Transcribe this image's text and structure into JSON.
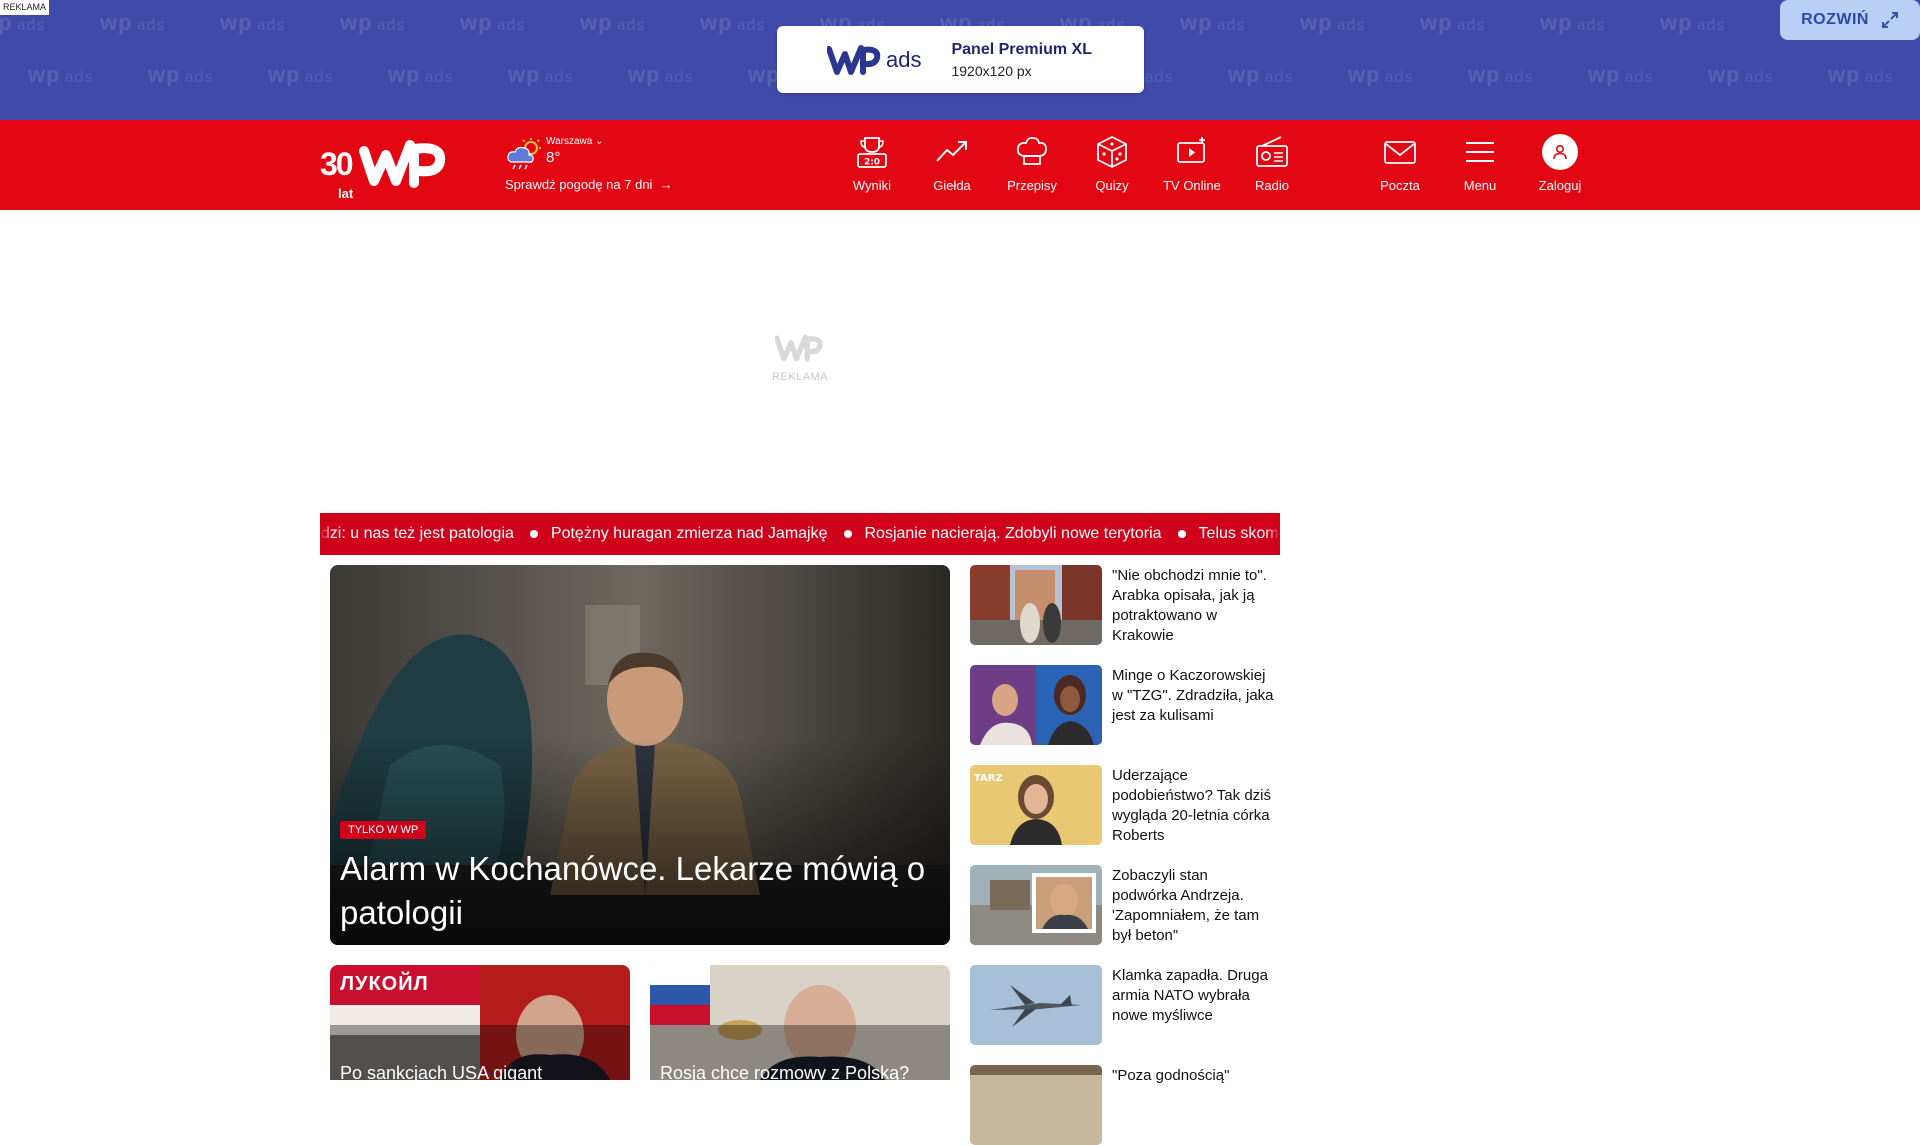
{
  "ad_banner": {
    "tag": "REKLAMA",
    "pattern_text": "wp",
    "pattern_suffix": "ads",
    "brand": "ads",
    "title": "Panel Premium XL",
    "subtitle": "1920x120 px",
    "expand_label": "ROZWIŃ",
    "background_color": "#3f4aa9"
  },
  "header": {
    "logo_years": "30",
    "logo_years_suffix": "lat",
    "brand_color": "#e30613",
    "weather": {
      "city": "Warszawa",
      "temperature": "8°",
      "forecast_link": "Sprawdź pogodę na 7 dni"
    },
    "nav": [
      {
        "label": "Wyniki",
        "icon": "trophy-score-icon"
      },
      {
        "label": "Giełda",
        "icon": "trending-up-icon"
      },
      {
        "label": "Przepisy",
        "icon": "chef-hat-icon"
      },
      {
        "label": "Quizy",
        "icon": "dice-icon"
      },
      {
        "label": "TV Online",
        "icon": "tv-play-icon"
      },
      {
        "label": "Radio",
        "icon": "radio-icon"
      }
    ],
    "account_nav": [
      {
        "label": "Poczta",
        "icon": "mail-icon"
      },
      {
        "label": "Menu",
        "icon": "hamburger-menu-icon"
      },
      {
        "label": "Zaloguj",
        "icon": "user-icon"
      }
    ]
  },
  "ad_slot": {
    "label": "REKLAMA"
  },
  "ticker": {
    "items": [
      "odzi: u nas też jest patologia",
      "Potężny huragan zmierza nad Jamajkę",
      "Rosjanie nacierają. Zdobyli nowe terytoria",
      "Telus skomentował swoje"
    ]
  },
  "main_story": {
    "badge": "TYLKO W WP",
    "headline": "Alarm w Kochanówce. Lekarze mówią o patologii"
  },
  "sub_stories": [
    {
      "title": "Po sankcjach USA gigant",
      "sign_text": "ЛУКОЙЛ"
    },
    {
      "title": "Rosja chce rozmowy z Polską?"
    }
  ],
  "side_stories": [
    {
      "title": "\"Nie obchodzi mnie to\". Arabka opisała, jak ją potraktowano w Krakowie"
    },
    {
      "title": "Minge o Kaczorowskiej w \"TZG\". Zdradziła, jaka jest za kulisami"
    },
    {
      "title": "Uderzające podobieństwo? Tak dziś wygląda 20-letnia córka Roberts"
    },
    {
      "title": "Zobaczyli stan podwórka Andrzeja. 'Zapomniałem, że tam był beton\""
    },
    {
      "title": "Klamka zapadła. Druga armia NATO wybrała nowe myśliwce"
    },
    {
      "title": "\"Poza godnością\""
    }
  ]
}
